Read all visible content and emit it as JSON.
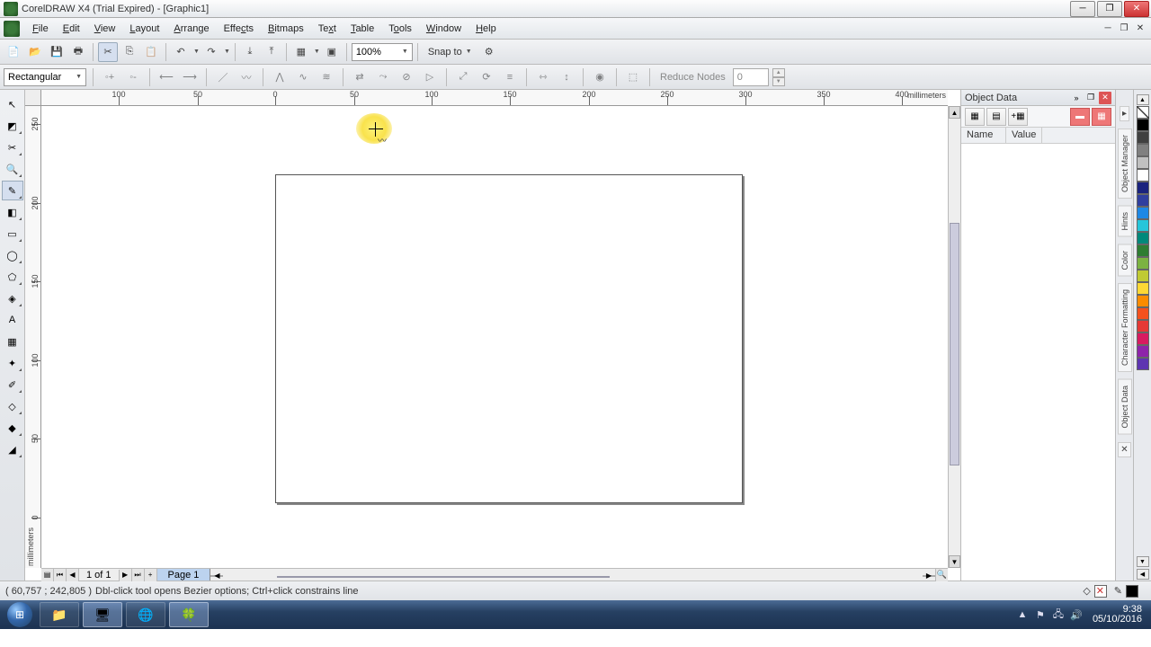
{
  "window": {
    "title": "CorelDRAW X4 (Trial Expired) - [Graphic1]"
  },
  "menus": [
    "File",
    "Edit",
    "View",
    "Layout",
    "Arrange",
    "Effects",
    "Bitmaps",
    "Text",
    "Table",
    "Tools",
    "Window",
    "Help"
  ],
  "toolbar": {
    "zoom": "100%",
    "snap_to": "Snap to"
  },
  "propbar": {
    "shape_mode": "Rectangular",
    "reduce_nodes_label": "Reduce Nodes",
    "reduce_nodes_value": "0"
  },
  "ruler": {
    "units": "millimeters",
    "h_labels": [
      "100",
      "50",
      "0",
      "50",
      "100",
      "150",
      "200",
      "250",
      "300",
      "350",
      "400"
    ],
    "v_labels": [
      "250",
      "200",
      "150",
      "100",
      "50",
      "0"
    ]
  },
  "docker": {
    "title": "Object Data",
    "columns": [
      "Name",
      "Value"
    ],
    "side_tabs": [
      "Object Manager",
      "Hints",
      "Color",
      "Character Formatting",
      "Object Data"
    ]
  },
  "palette": [
    "#000000",
    "#404040",
    "#808080",
    "#c0c0c0",
    "#ffffff",
    "#1a237e",
    "#303f9f",
    "#1e88e5",
    "#26c6da",
    "#00897b",
    "#2e7d32",
    "#7cb342",
    "#c0ca33",
    "#fdd835",
    "#fb8c00",
    "#f4511e",
    "#e53935",
    "#d81b60",
    "#8e24aa",
    "#5e35b1"
  ],
  "page_nav": {
    "counter": "1 of 1",
    "tab": "Page 1"
  },
  "status": {
    "coords": "( 60,757 ; 242,805 )",
    "hint": "Dbl-click tool opens Bezier options; Ctrl+click constrains line",
    "fill_color": "#000000"
  },
  "taskbar": {
    "time": "9:38",
    "date": "05/10/2016"
  }
}
